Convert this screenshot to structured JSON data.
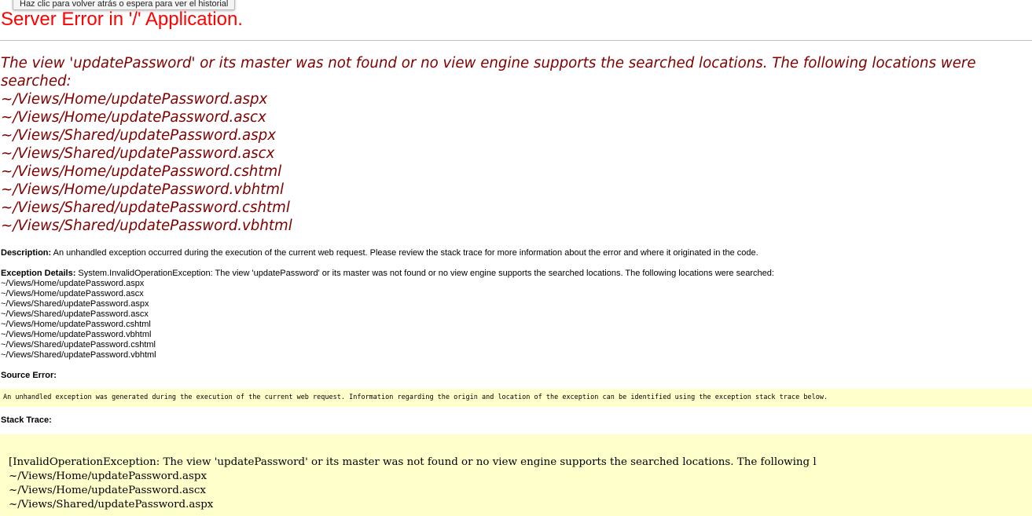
{
  "tooltip": "Haz clic para volver atrás o espera para ver el historial",
  "title": "Server Error in '/' Application.",
  "message": {
    "text": "The view 'updatePassword' or its master was not found or no view engine supports the searched locations. The following locations were searched:",
    "locations": [
      "~/Views/Home/updatePassword.aspx",
      "~/Views/Home/updatePassword.ascx",
      "~/Views/Shared/updatePassword.aspx",
      "~/Views/Shared/updatePassword.ascx",
      "~/Views/Home/updatePassword.cshtml",
      "~/Views/Home/updatePassword.vbhtml",
      "~/Views/Shared/updatePassword.cshtml",
      "~/Views/Shared/updatePassword.vbhtml"
    ]
  },
  "description": {
    "label": "Description:",
    "text": "An unhandled exception occurred during the execution of the current web request. Please review the stack trace for more information about the error and where it originated in the code."
  },
  "exception_details": {
    "label": "Exception Details:",
    "text": "System.InvalidOperationException: The view 'updatePassword' or its master was not found or no view engine supports the searched locations. The following locations were searched:",
    "locations": [
      "~/Views/Home/updatePassword.aspx",
      "~/Views/Home/updatePassword.ascx",
      "~/Views/Shared/updatePassword.aspx",
      "~/Views/Shared/updatePassword.ascx",
      "~/Views/Home/updatePassword.cshtml",
      "~/Views/Home/updatePassword.vbhtml",
      "~/Views/Shared/updatePassword.cshtml",
      "~/Views/Shared/updatePassword.vbhtml"
    ]
  },
  "source_error": {
    "label": "Source Error:",
    "text": "An unhandled exception was generated during the execution of the current web request. Information regarding the origin and location of the exception can be identified using the exception stack trace below."
  },
  "stack_trace": {
    "label": "Stack Trace:",
    "lines": [
      "[InvalidOperationException: The view 'updatePassword' or its master was not found or no view engine supports the searched locations. The following l",
      "~/Views/Home/updatePassword.aspx",
      "~/Views/Home/updatePassword.ascx",
      "~/Views/Shared/updatePassword.aspx"
    ]
  },
  "colors": {
    "title": "#ff0000",
    "message": "#800000",
    "code_background": "#ffffcc"
  }
}
